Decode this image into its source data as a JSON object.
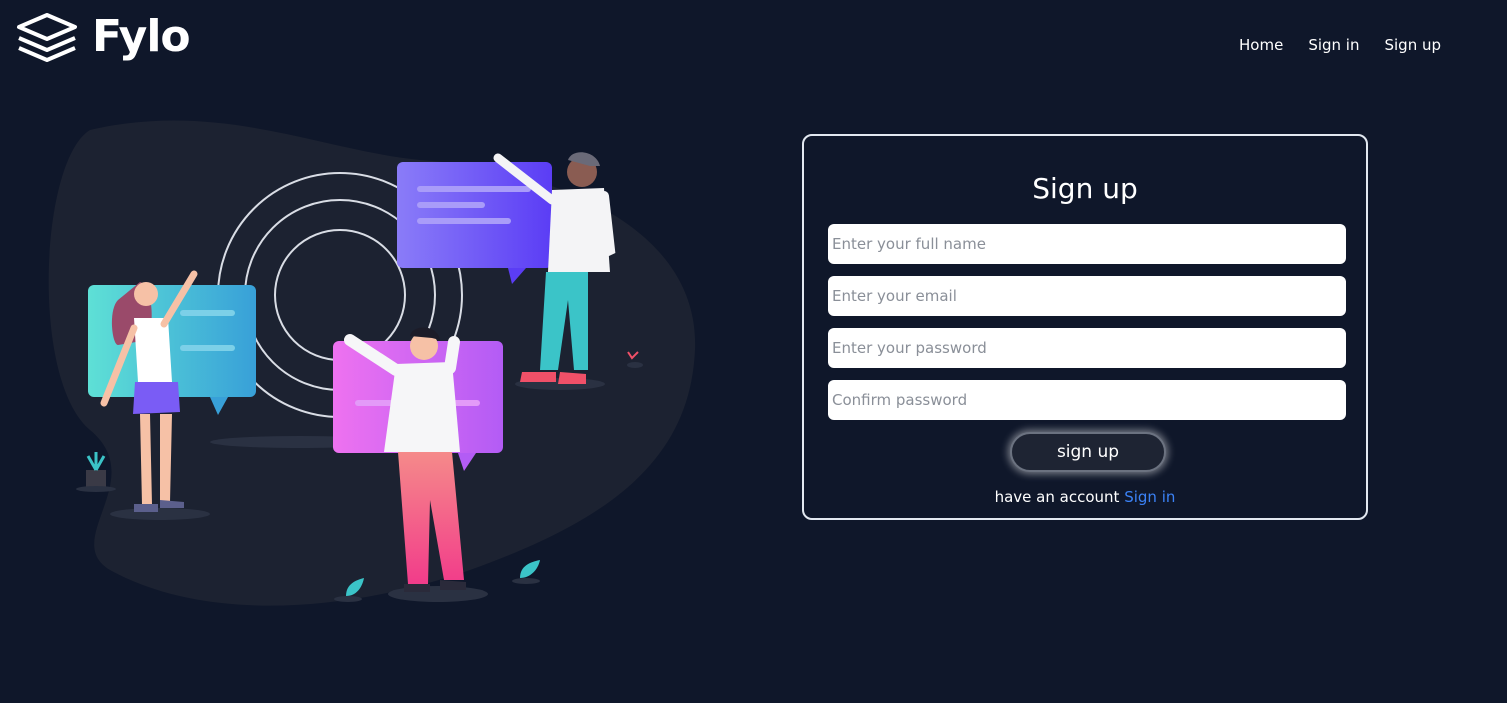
{
  "brand": {
    "name": "Fylo",
    "icon": "stacked-layers-icon"
  },
  "nav": {
    "items": [
      "Home",
      "Sign in",
      "Sign up"
    ]
  },
  "form": {
    "title": "Sign up",
    "fields": {
      "full_name": {
        "placeholder": "Enter your full name",
        "value": ""
      },
      "email": {
        "placeholder": "Enter your email",
        "value": ""
      },
      "password": {
        "placeholder": "Enter your password",
        "value": ""
      },
      "confirm": {
        "placeholder": "Confirm password",
        "value": ""
      }
    },
    "submit_label": "sign up",
    "account_text": "have an account",
    "signin_link": "Sign in"
  },
  "colors": {
    "background": "#0f172a",
    "link": "#3b82f6",
    "border": "#e2e8f0"
  }
}
